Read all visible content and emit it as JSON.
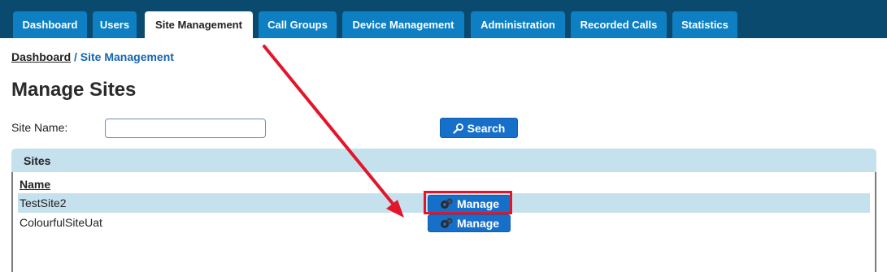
{
  "nav": {
    "tabs": [
      {
        "label": "Dashboard",
        "active": false
      },
      {
        "label": "Users",
        "active": false
      },
      {
        "label": "Site Management",
        "active": true
      },
      {
        "label": "Call Groups",
        "active": false
      },
      {
        "label": "Device Management",
        "active": false
      },
      {
        "label": "Administration",
        "active": false
      },
      {
        "label": "Recorded Calls",
        "active": false
      },
      {
        "label": "Statistics",
        "active": false
      }
    ]
  },
  "breadcrumb": {
    "root": "Dashboard",
    "separator": "/",
    "current": "Site Management"
  },
  "page": {
    "title": "Manage Sites"
  },
  "search": {
    "label": "Site Name:",
    "value": "",
    "button_label": "Search",
    "button_icon": "magnifier-icon"
  },
  "sites": {
    "panel_title": "Sites",
    "column_header": "Name",
    "rows": [
      {
        "name": "TestSite2",
        "action_label": "Manage",
        "action_icon": "gears-icon",
        "highlighted": true
      },
      {
        "name": "ColourfulSiteUat",
        "action_label": "Manage",
        "action_icon": "gears-icon",
        "highlighted": false
      }
    ]
  },
  "colors": {
    "tabbar_bg": "#0b4a6f",
    "tab_bg": "#0e7fc2",
    "button_bg": "#1670c9",
    "panel_bg": "#c5e1ee",
    "annotation": "#e3152b"
  }
}
